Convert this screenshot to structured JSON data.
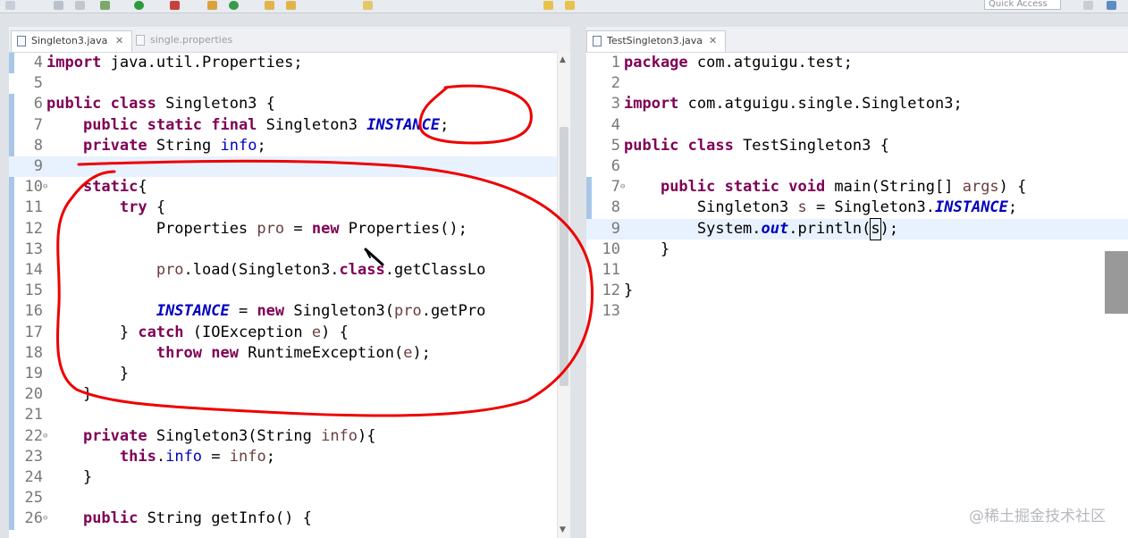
{
  "toolbar": {
    "quick_access_placeholder": "Quick Access",
    "icons": [
      "new-icon",
      "save-icon",
      "print-icon",
      "debug-icon",
      "run-icon",
      "external-tools-icon",
      "package-icon",
      "refresh-icon",
      "open-folder-icon",
      "open-type-icon",
      "search-icon",
      "back-icon",
      "forward-icon"
    ]
  },
  "left_editor": {
    "tabs": [
      {
        "label": "Singleton3.java",
        "active": true
      },
      {
        "label": "single.properties",
        "active": false
      }
    ],
    "lines": [
      {
        "n": "4",
        "html": "<span class=\"kw\">import</span> java.util.Properties;"
      },
      {
        "n": "5",
        "html": ""
      },
      {
        "n": "6",
        "html": "<span class=\"kw\">public class</span> Singleton3 {"
      },
      {
        "n": "7",
        "html": "    <span class=\"kw\">public static final</span> Singleton3 <span class=\"sfield\">INSTANCE</span>;"
      },
      {
        "n": "8",
        "html": "    <span class=\"kw\">private</span> String <span class=\"field\">info</span>;"
      },
      {
        "n": "9",
        "html": ""
      },
      {
        "n": "10",
        "html": "    <span class=\"kw\">static</span>{"
      },
      {
        "n": "11",
        "html": "        <span class=\"kw\">try</span> {"
      },
      {
        "n": "12",
        "html": "            Properties <span class=\"local\">pro</span> = <span class=\"kw\">new</span> Properties();"
      },
      {
        "n": "13",
        "html": ""
      },
      {
        "n": "14",
        "html": "            <span class=\"local\">pro</span>.load(Singleton3.<span class=\"kw\">class</span>.getClassLo"
      },
      {
        "n": "15",
        "html": ""
      },
      {
        "n": "16",
        "html": "            <span class=\"sitalic\">INSTANCE</span> = <span class=\"kw\">new</span> Singleton3(<span class=\"local\">pro</span>.getPro"
      },
      {
        "n": "17",
        "html": "        } <span class=\"kw\">catch</span> (IOException <span class=\"local\">e</span>) {"
      },
      {
        "n": "18",
        "html": "            <span class=\"kw\">throw new</span> RuntimeException(<span class=\"local\">e</span>);"
      },
      {
        "n": "19",
        "html": "        }"
      },
      {
        "n": "20",
        "html": "    }"
      },
      {
        "n": "21",
        "html": ""
      },
      {
        "n": "22",
        "html": "    <span class=\"kw\">private</span> Singleton3(String <span class=\"local\">info</span>){"
      },
      {
        "n": "23",
        "html": "        <span class=\"kw\">this</span>.<span class=\"field\">info</span> = <span class=\"local\">info</span>;"
      },
      {
        "n": "24",
        "html": "    }"
      },
      {
        "n": "25",
        "html": ""
      },
      {
        "n": "26",
        "html": "    <span class=\"kw\">public</span> String getInfo() {"
      }
    ],
    "folded_lines": [
      "10",
      "22",
      "26"
    ],
    "current_line": "9"
  },
  "right_editor": {
    "tabs": [
      {
        "label": "TestSingleton3.java",
        "active": true
      }
    ],
    "lines": [
      {
        "n": "1",
        "html": "<span class=\"kw\">package</span> com.atguigu.test;"
      },
      {
        "n": "2",
        "html": ""
      },
      {
        "n": "3",
        "html": "<span class=\"kw\">import</span> com.atguigu.single.Singleton3;"
      },
      {
        "n": "4",
        "html": ""
      },
      {
        "n": "5",
        "html": "<span class=\"kw\">public class</span> TestSingleton3 {"
      },
      {
        "n": "6",
        "html": ""
      },
      {
        "n": "7",
        "html": "    <span class=\"kw\">public static void</span> main(String[] <span class=\"local\">args</span>) {"
      },
      {
        "n": "8",
        "html": "        Singleton3 <span class=\"local\">s</span> = Singleton3.<span class=\"sfield\">INSTANCE</span>;"
      },
      {
        "n": "9",
        "html": "        System.<span class=\"sfield\">out</span>.println(<span class=\"caret-box\">s</span>);"
      },
      {
        "n": "10",
        "html": "    }"
      },
      {
        "n": "11",
        "html": ""
      },
      {
        "n": "12",
        "html": "}"
      },
      {
        "n": "13",
        "html": ""
      }
    ],
    "folded_lines": [
      "7"
    ],
    "current_line": "9"
  },
  "watermark": "@稀土掘金技术社区",
  "colors": {
    "keyword": "#7f0055",
    "field": "#0000c0",
    "local": "#6a3e3e",
    "annotation": "#ee0000"
  }
}
